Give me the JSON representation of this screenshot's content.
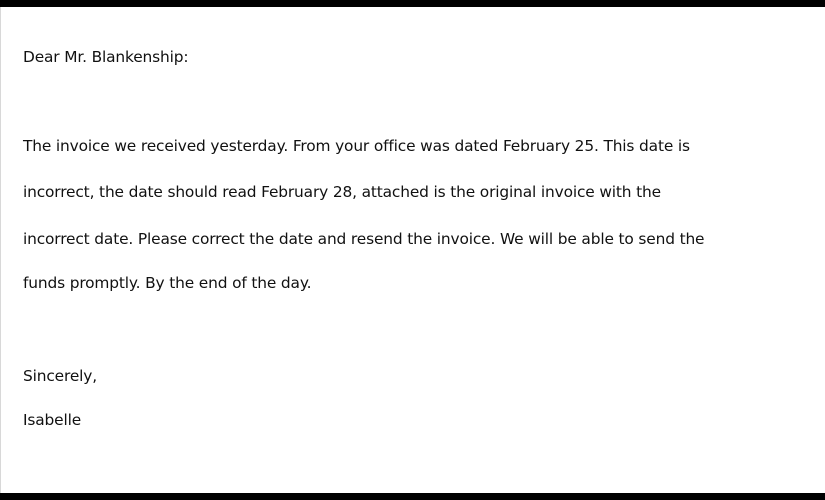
{
  "letter": {
    "greeting": "Dear Mr. Blankenship:",
    "body_lines": [
      "The invoice we received yesterday. From your office was dated February 25.  This date is",
      "incorrect, the date should read February 28, attached is the original invoice with the",
      "incorrect date. Please correct the date and resend the invoice. We will be able to send the",
      "funds promptly. By the end of the day."
    ],
    "closing": "Sincerely,",
    "signature": "Isabelle"
  }
}
